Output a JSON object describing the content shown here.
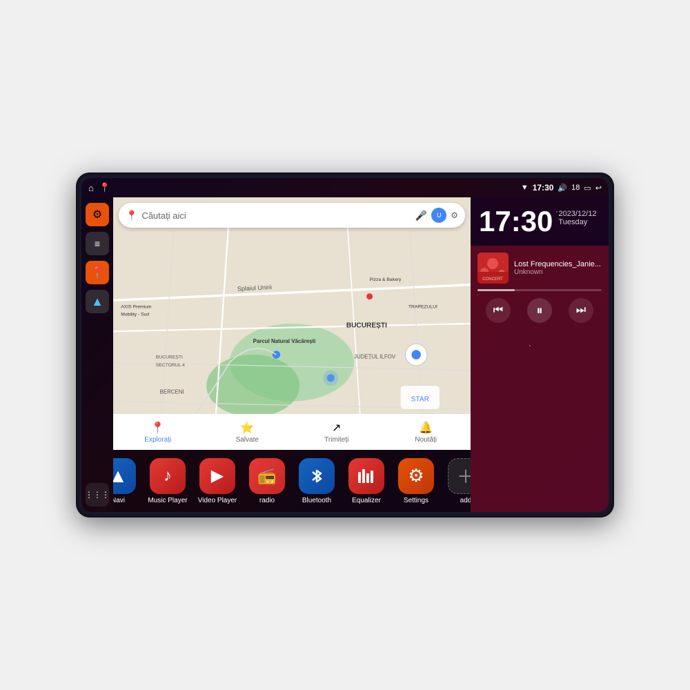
{
  "device": {
    "title": "Car Head Unit"
  },
  "statusBar": {
    "wifi_icon": "▼",
    "time": "17:30",
    "volume_icon": "🔊",
    "battery_num": "18",
    "battery_icon": "🔋",
    "back_icon": "↩",
    "home_icon": "⌂",
    "map_icon": "📍"
  },
  "sidebar": {
    "settings_icon": "⚙",
    "files_icon": "▬",
    "map_icon": "📍",
    "nav_icon": "▲",
    "grid_icon": "⋮⋮⋮"
  },
  "map": {
    "search_placeholder": "Căutați aici",
    "search_icon": "📍",
    "areas": [
      "Parcul Natural Văcărești",
      "BUCUREȘTI",
      "JUDEȚUL ILFOV",
      "BERCENI",
      "SECTORUL 4",
      "AXIS Premium Mobility - Sud",
      "Pizza & Bakery",
      "TRAPEZULUI"
    ],
    "nav_items": [
      {
        "label": "Explorați",
        "icon": "📍"
      },
      {
        "label": "Salvate",
        "icon": "⭐"
      },
      {
        "label": "Trimiteți",
        "icon": "↗"
      },
      {
        "label": "Noutăți",
        "icon": "🔔"
      }
    ]
  },
  "clock": {
    "time": "17:30",
    "date": "2023/12/12",
    "day": "Tuesday"
  },
  "music": {
    "title": "Lost Frequencies_Janie...",
    "artist": "Unknown",
    "progress": 30
  },
  "controls": {
    "prev": "⏮",
    "pause": "⏸",
    "next": "⏭"
  },
  "apps": [
    {
      "id": "navi",
      "label": "Navi",
      "icon": "▲",
      "colorClass": "navi-bg"
    },
    {
      "id": "music-player",
      "label": "Music Player",
      "icon": "♪",
      "colorClass": "music-bg"
    },
    {
      "id": "video-player",
      "label": "Video Player",
      "icon": "▶",
      "colorClass": "video-bg"
    },
    {
      "id": "radio",
      "label": "radio",
      "icon": "📻",
      "colorClass": "radio-bg"
    },
    {
      "id": "bluetooth",
      "label": "Bluetooth",
      "icon": "⚡",
      "colorClass": "bt-bg"
    },
    {
      "id": "equalizer",
      "label": "Equalizer",
      "icon": "≋",
      "colorClass": "eq-bg"
    },
    {
      "id": "settings",
      "label": "Settings",
      "icon": "⚙",
      "colorClass": "settings-bg"
    },
    {
      "id": "add",
      "label": "add",
      "icon": "＋",
      "colorClass": "add-bg"
    }
  ]
}
